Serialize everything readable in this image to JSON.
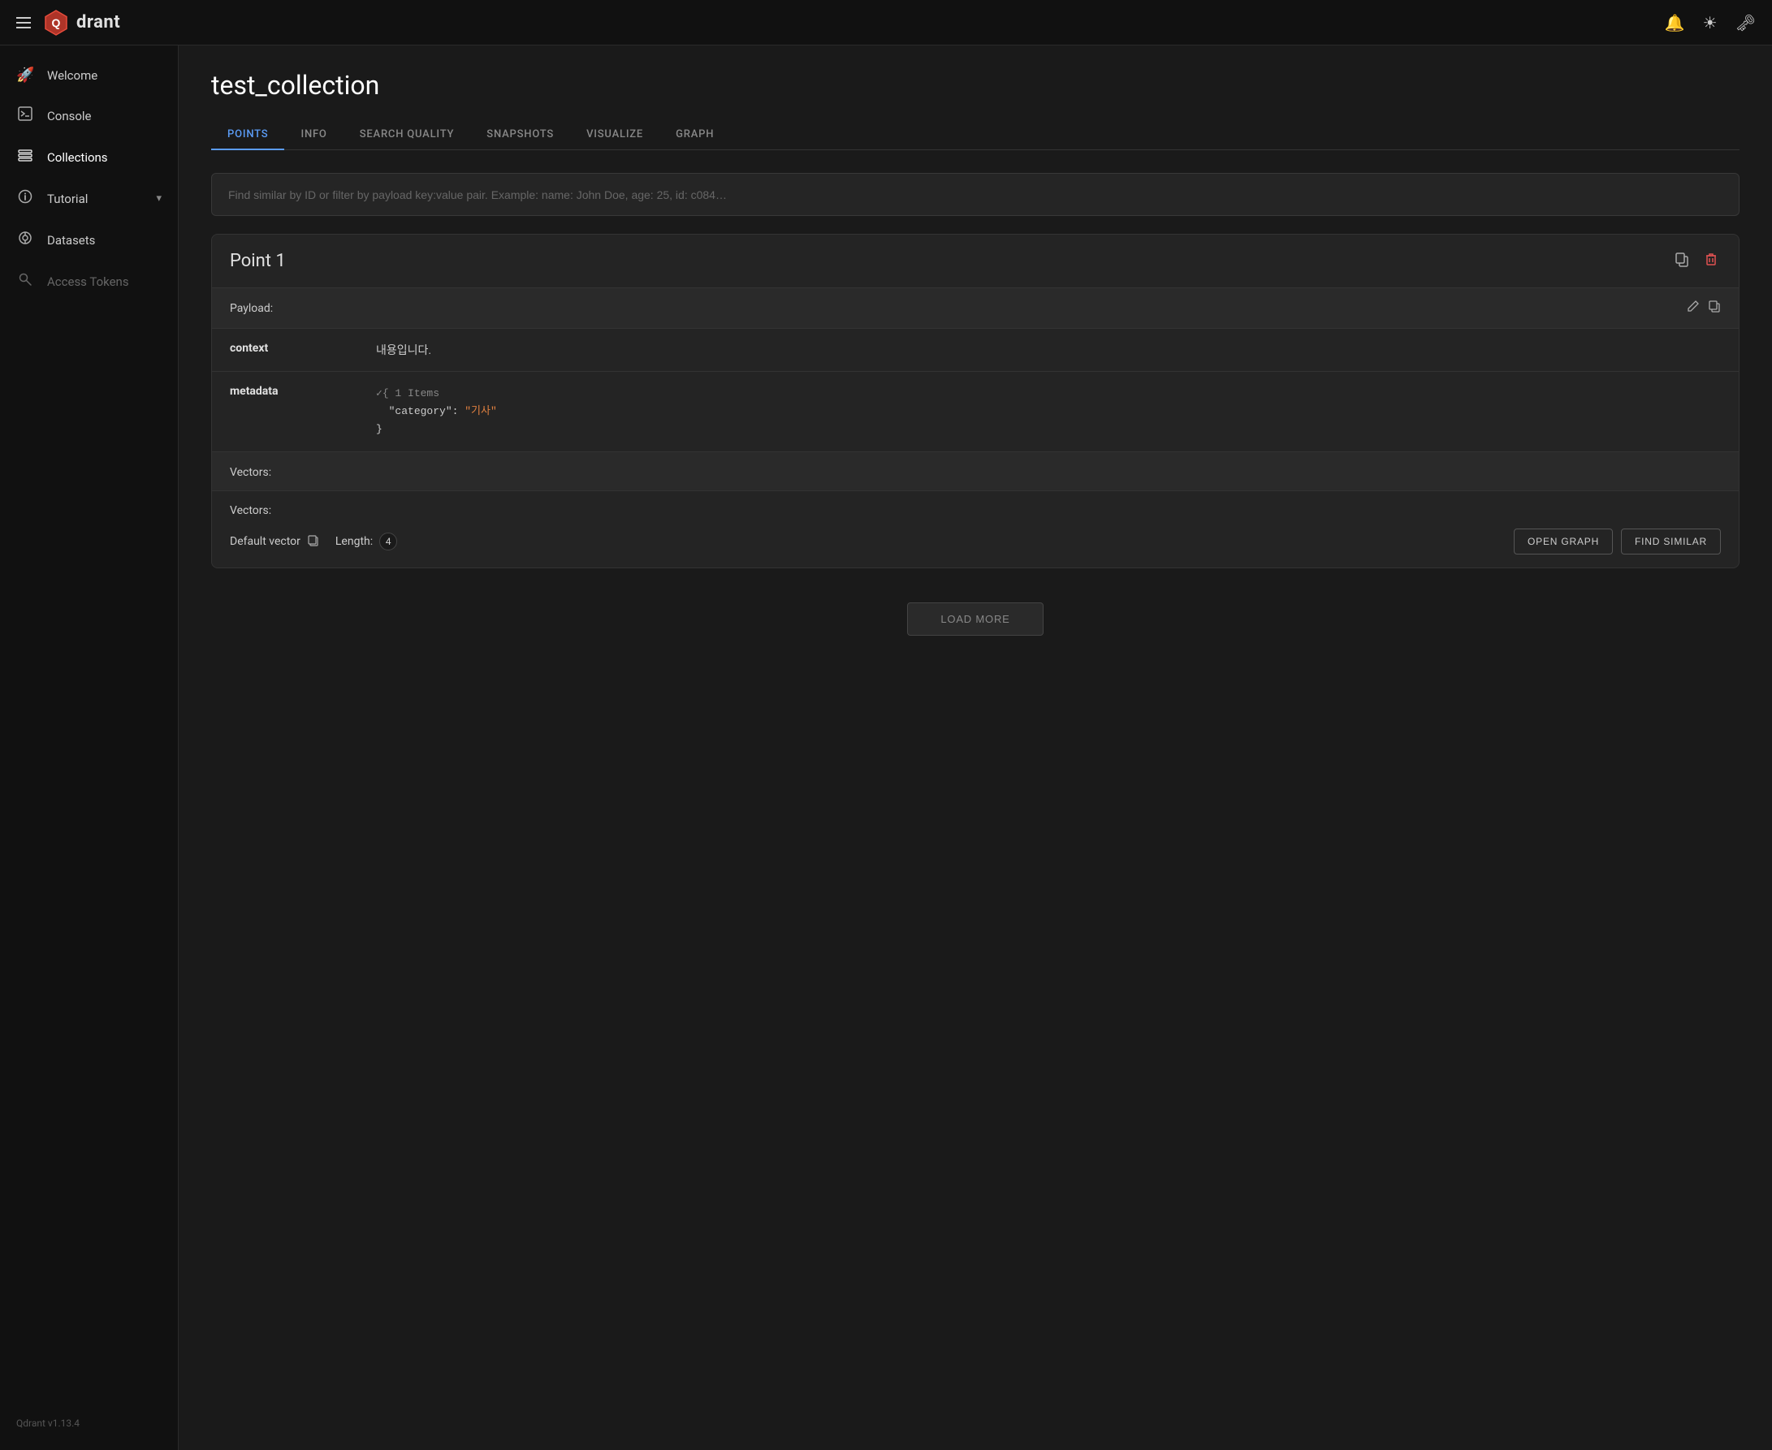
{
  "topbar": {
    "menu_label": "Menu",
    "logo_text": "drant",
    "notification_icon": "🔔",
    "theme_icon": "☀",
    "key_icon": "🔑"
  },
  "sidebar": {
    "items": [
      {
        "id": "welcome",
        "label": "Welcome",
        "icon": "🚀",
        "active": false,
        "muted": false
      },
      {
        "id": "console",
        "label": "Console",
        "icon": "🖥",
        "active": false,
        "muted": false
      },
      {
        "id": "collections",
        "label": "Collections",
        "icon": "📋",
        "active": true,
        "muted": false
      },
      {
        "id": "tutorial",
        "label": "Tutorial",
        "icon": "💡",
        "active": false,
        "muted": false,
        "has_chevron": true
      },
      {
        "id": "datasets",
        "label": "Datasets",
        "icon": "🔗",
        "active": false,
        "muted": false
      },
      {
        "id": "access-tokens",
        "label": "Access Tokens",
        "icon": "🔑",
        "active": false,
        "muted": true
      }
    ],
    "footer_version": "Qdrant v1.13.4"
  },
  "page": {
    "title": "test_collection",
    "tabs": [
      {
        "id": "points",
        "label": "POINTS",
        "active": true
      },
      {
        "id": "info",
        "label": "INFO",
        "active": false
      },
      {
        "id": "search-quality",
        "label": "SEARCH QUALITY",
        "active": false
      },
      {
        "id": "snapshots",
        "label": "SNAPSHOTS",
        "active": false
      },
      {
        "id": "visualize",
        "label": "VISUALIZE",
        "active": false
      },
      {
        "id": "graph",
        "label": "GRAPH",
        "active": false
      }
    ],
    "search_placeholder": "Find similar by ID or filter by payload key:value pair. Example: name: John Doe, age: 25, id: c084…"
  },
  "point": {
    "title": "Point 1",
    "payload_label": "Payload:",
    "context_key": "context",
    "context_value": "내용입니다.",
    "metadata_key": "metadata",
    "metadata_json_line1": "✓{ 1 Items",
    "metadata_json_line2": "  \"category\": \"기사\"",
    "metadata_json_line3": "}",
    "category_value": "\"기사\"",
    "vectors_label": "Vectors:",
    "vectors_detail_label": "Vectors:",
    "default_vector_label": "Default vector",
    "length_label": "Length:",
    "length_value": "4",
    "open_graph_label": "OPEN GRAPH",
    "find_similar_label": "FIND SIMILAR",
    "load_more_label": "LOAD MORE"
  }
}
